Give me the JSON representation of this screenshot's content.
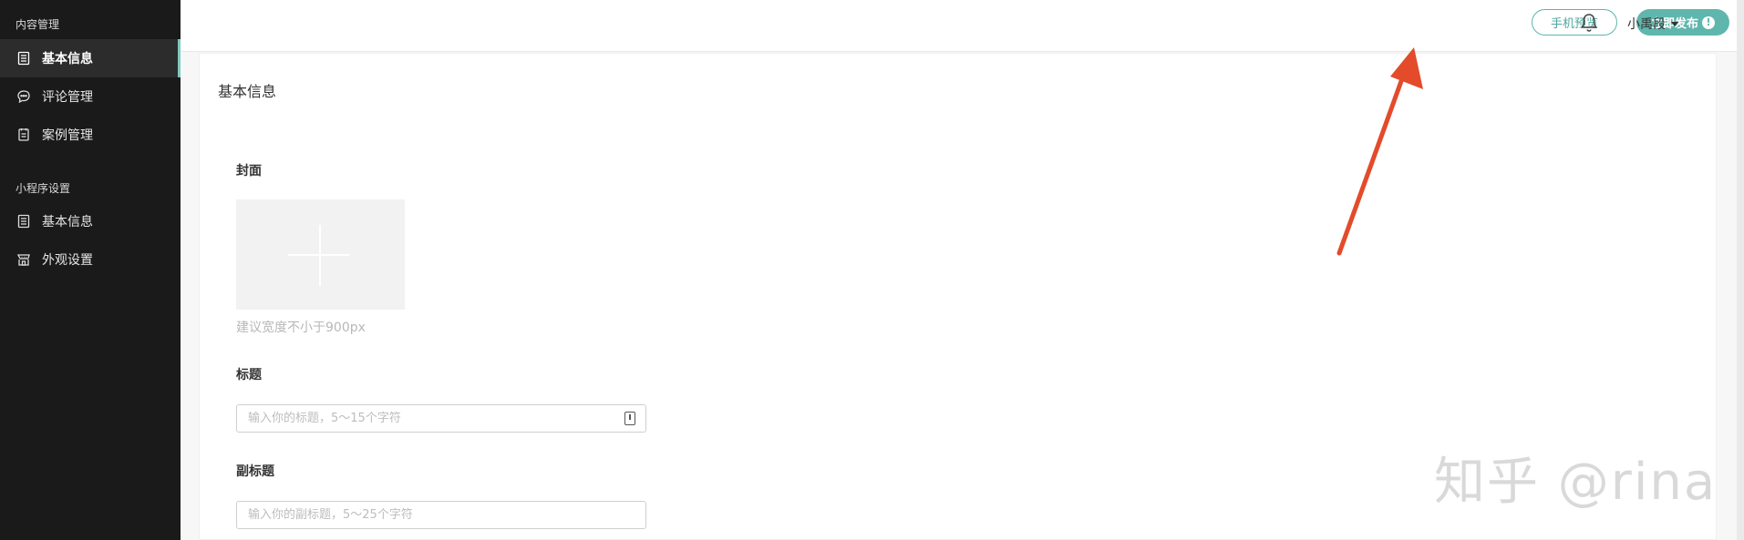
{
  "sidebar": {
    "section1_title": "内容管理",
    "section2_title": "小程序设置",
    "items": [
      {
        "label": "基本信息",
        "icon": "document-list-icon",
        "active": true
      },
      {
        "label": "评论管理",
        "icon": "chat-bubble-icon",
        "active": false
      },
      {
        "label": "案例管理",
        "icon": "notebook-icon",
        "active": false
      },
      {
        "label": "基本信息",
        "icon": "document-list-icon",
        "active": false
      },
      {
        "label": "外观设置",
        "icon": "storefront-icon",
        "active": false
      }
    ]
  },
  "topbar": {
    "preview_label": "手机预览",
    "publish_label": "立即发布",
    "publish_alert": "!",
    "user_name": "小禹段"
  },
  "main": {
    "title": "基本信息",
    "cover_label": "封面",
    "cover_hint": "建议宽度不小于900px",
    "title_label": "标题",
    "title_placeholder": "输入你的标题，5～15个字符",
    "subtitle_label": "副标题",
    "subtitle_placeholder": "输入你的副标题，5～25个字符"
  },
  "watermark": "知乎 @rina",
  "colors": {
    "accent": "#5fb6ad",
    "sidebar_bg": "#1a1a1a",
    "arrow": "#e34b2b"
  }
}
